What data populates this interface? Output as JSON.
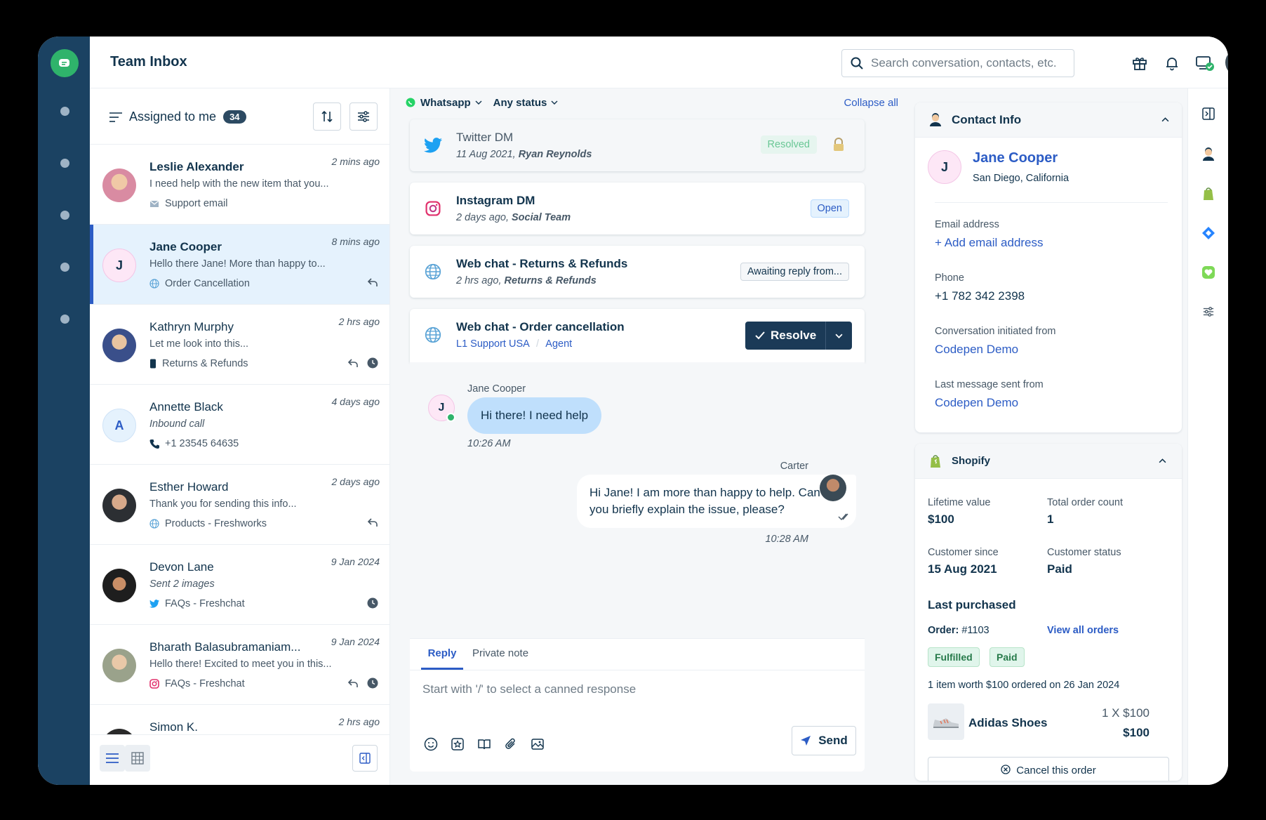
{
  "topbar": {
    "title": "Team Inbox",
    "search_placeholder": "Search conversation, contacts, etc."
  },
  "list": {
    "filter_label": "Assigned to me",
    "count": "34",
    "items": [
      {
        "name": "Leslie Alexander",
        "time": "2 mins ago",
        "preview": "I need help with the new item that you...",
        "tag": "Support email",
        "tag_icon": "email-icon"
      },
      {
        "name": "Jane Cooper",
        "time": "8 mins ago",
        "preview": "Hello there Jane! More than happy to...",
        "tag": "Order Cancellation",
        "tag_icon": "globe-icon",
        "initial": "J"
      },
      {
        "name": "Kathryn Murphy",
        "time": "2 hrs ago",
        "preview": "Let me look into this...",
        "tag": "Returns & Refunds",
        "tag_icon": "mobile-icon"
      },
      {
        "name": "Annette Black",
        "time": "4 days ago",
        "preview": "Inbound call",
        "tag": "+1 23545 64635",
        "tag_icon": "phone-icon",
        "initial": "A"
      },
      {
        "name": "Esther Howard",
        "time": "2 days ago",
        "preview": "Thank you for sending this info...",
        "tag": "Products - Freshworks",
        "tag_icon": "globe-icon"
      },
      {
        "name": "Devon Lane",
        "time": "9 Jan 2024",
        "preview": "Sent 2 images",
        "tag": "FAQs - Freshchat",
        "tag_icon": "twitter-icon"
      },
      {
        "name": "Bharath Balasubramaniam...",
        "time": "9 Jan 2024",
        "preview": "Hello there! Excited to meet you in this...",
        "tag": "FAQs - Freshchat",
        "tag_icon": "instagram-icon"
      },
      {
        "name": "Simon K.",
        "time": "2 hrs ago"
      }
    ]
  },
  "middle": {
    "channel_filter": "Whatsapp",
    "status_filter": "Any status",
    "collapse": "Collapse all",
    "cards": [
      {
        "title": "Twitter DM",
        "sub_date": "11 Aug 2021,",
        "sub_who": "Ryan Reynolds",
        "status": "Resolved"
      },
      {
        "title": "Instagram DM",
        "sub_date": "2 days ago,",
        "sub_who": "Social Team",
        "status": "Open"
      },
      {
        "title": "Web chat - Returns & Refunds",
        "sub_date": "2 hrs ago,",
        "sub_who": "Returns & Refunds",
        "status": "Awaiting reply from..."
      },
      {
        "title": "Web chat - Order cancellation",
        "group": "L1 Support USA",
        "sep": "/",
        "role": "Agent",
        "resolve": "Resolve"
      }
    ],
    "chat": {
      "in_name": "Jane Cooper",
      "in_initial": "J",
      "in_text": "Hi there! I need help",
      "in_time": "10:26 AM",
      "out_name": "Carter",
      "out_text_1": "Hi Jane! I am more than happy to help. Can",
      "out_text_2": "you briefly explain the issue, please?",
      "out_time": "10:28 AM"
    },
    "reply": {
      "tab_reply": "Reply",
      "tab_note": "Private note",
      "placeholder": "Start with '/' to select a canned response",
      "send": "Send"
    }
  },
  "contact": {
    "header": "Contact Info",
    "initial": "J",
    "name": "Jane Cooper",
    "location": "San Diego, California",
    "email_label": "Email address",
    "email_action": "+ Add email address",
    "phone_label": "Phone",
    "phone": "+1 782 342 2398",
    "initiated_label": "Conversation initiated from",
    "initiated": "Codepen Demo",
    "last_label": "Last message sent from",
    "last": "Codepen Demo"
  },
  "shopify": {
    "header": "Shopify",
    "lifetime_label": "Lifetime value",
    "lifetime": "$100",
    "orders_label": "Total order count",
    "orders": "1",
    "since_label": "Customer since",
    "since": "15 Aug 2021",
    "status_label": "Customer status",
    "status": "Paid",
    "last_purchased": "Last purchased",
    "order_label": "Order:",
    "order_no": "#1103",
    "view_all": "View all orders",
    "badge_fulfilled": "Fulfilled",
    "badge_paid": "Paid",
    "summary": "1 item worth $100 ordered on 26 Jan 2024",
    "product": "Adidas Shoes",
    "qty": "1 X $100",
    "price": "$100",
    "cancel": "Cancel this order"
  },
  "colors": {
    "rail": "#1b4262",
    "accent": "#2c5cc5",
    "resolve": "#1b3a57",
    "green": "#2fb36b"
  }
}
